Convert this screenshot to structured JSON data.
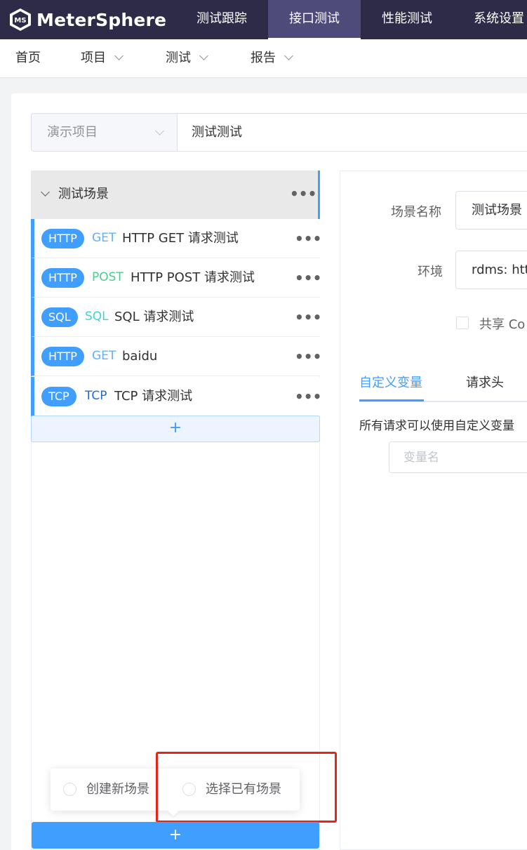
{
  "brand": {
    "name": "MeterSphere",
    "mark_text": "MS"
  },
  "topnav": {
    "items": [
      "测试跟踪",
      "接口测试",
      "性能测试",
      "系统设置"
    ],
    "active": "接口测试"
  },
  "subnav": {
    "items": [
      "首页",
      "项目",
      "测试",
      "报告"
    ]
  },
  "project": {
    "selected": "演示项目",
    "test_name": "测试测试"
  },
  "scenario": {
    "title": "测试场景",
    "requests": [
      {
        "protocol": "HTTP",
        "method": "GET",
        "method_color": "#61affe",
        "name": "HTTP GET 请求测试"
      },
      {
        "protocol": "HTTP",
        "method": "POST",
        "method_color": "#49cc90",
        "name": "HTTP POST 请求测试"
      },
      {
        "protocol": "SQL",
        "method": "SQL",
        "method_color": "#3dd2d8",
        "name": "SQL 请求测试"
      },
      {
        "protocol": "HTTP",
        "method": "GET",
        "method_color": "#61affe",
        "name": "baidu"
      },
      {
        "protocol": "TCP",
        "method": "TCP",
        "method_color": "#2768d8",
        "name": "TCP 请求测试"
      }
    ],
    "add_request": "+",
    "add_scenario": "+"
  },
  "popover": {
    "options": [
      "创建新场景",
      "选择已有场景"
    ]
  },
  "form": {
    "name_label": "场景名称",
    "name_value": "测试场景",
    "env_label": "环境",
    "env_value": "rdms: http",
    "share_cookie_label": "共享 Co",
    "tabs": [
      "自定义变量",
      "请求头"
    ],
    "active_tab": "自定义变量",
    "hint": "所有请求可以使用自定义变量",
    "var_placeholder": "变量名"
  },
  "colors": {
    "nav_bg": "#2d2b48",
    "accent": "#409eff",
    "highlight": "#e5251b"
  }
}
